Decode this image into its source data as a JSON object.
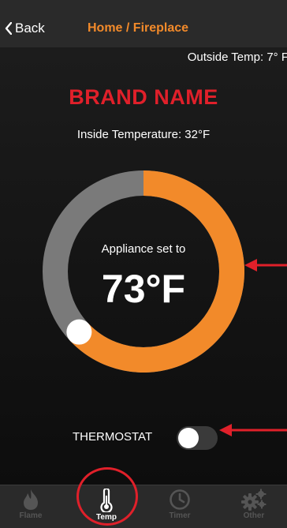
{
  "nav": {
    "back_label": "Back",
    "title": "Home / Fireplace"
  },
  "outside_temp": "Outside Temp: 7° F",
  "brand": "BRAND NAME",
  "inside_temp": "Inside Temperature: 32°F",
  "dial": {
    "label": "Appliance set to",
    "value": "73°F",
    "progress": 0.63
  },
  "thermostat": {
    "label": "THERMOSTAT",
    "on": false
  },
  "tabs": [
    {
      "label": "Flame",
      "icon": "flame-icon",
      "active": false
    },
    {
      "label": "Temp",
      "icon": "thermometer-icon",
      "active": true
    },
    {
      "label": "Timer",
      "icon": "clock-icon",
      "active": false
    },
    {
      "label": "Other",
      "icon": "gear-icon",
      "active": false
    }
  ],
  "colors": {
    "accent": "#f28a2a",
    "brand": "#e0202a",
    "track": "#7a7a7a"
  }
}
